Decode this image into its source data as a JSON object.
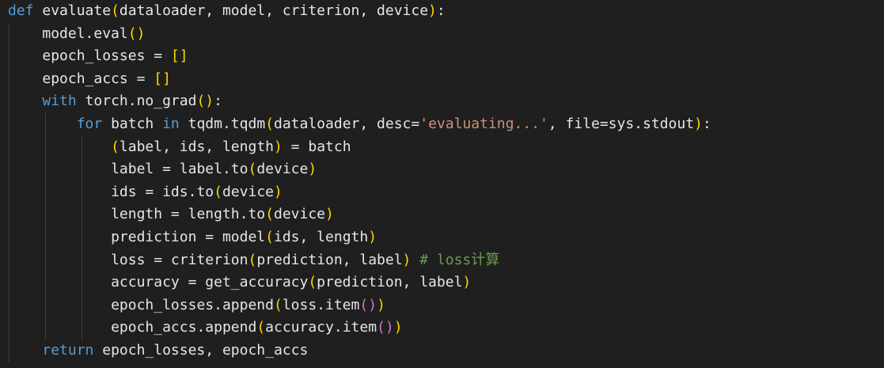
{
  "editor": {
    "language": "python",
    "theme_colors": {
      "background": "#1f1f1f",
      "keyword": "#569cd6",
      "function": "#dcdcaa",
      "string": "#ce9178",
      "comment": "#6a9955",
      "bracket_level_1": "#ffd700",
      "bracket_level_2": "#da70d6",
      "text": "#e6e6e6"
    },
    "lines": [
      {
        "indent": 0,
        "tokens": [
          {
            "t": "def",
            "c": "kw"
          },
          {
            "t": " ",
            "c": "txt"
          },
          {
            "t": "evaluate",
            "c": "txt"
          },
          {
            "t": "(",
            "c": "b1"
          },
          {
            "t": "dataloader, model, criterion, device",
            "c": "txt"
          },
          {
            "t": ")",
            "c": "b1"
          },
          {
            "t": ":",
            "c": "txt"
          }
        ]
      },
      {
        "indent": 1,
        "tokens": [
          {
            "t": "model.eval",
            "c": "txt"
          },
          {
            "t": "(",
            "c": "b1"
          },
          {
            "t": ")",
            "c": "b1"
          }
        ]
      },
      {
        "indent": 1,
        "tokens": [
          {
            "t": "epoch_losses = ",
            "c": "txt"
          },
          {
            "t": "[",
            "c": "b1"
          },
          {
            "t": "]",
            "c": "b1"
          }
        ]
      },
      {
        "indent": 1,
        "tokens": [
          {
            "t": "epoch_accs = ",
            "c": "txt"
          },
          {
            "t": "[",
            "c": "b1"
          },
          {
            "t": "]",
            "c": "b1"
          }
        ]
      },
      {
        "indent": 1,
        "tokens": [
          {
            "t": "with",
            "c": "kw"
          },
          {
            "t": " torch.no_grad",
            "c": "txt"
          },
          {
            "t": "(",
            "c": "b1"
          },
          {
            "t": ")",
            "c": "b1"
          },
          {
            "t": ":",
            "c": "txt"
          }
        ]
      },
      {
        "indent": 2,
        "tokens": [
          {
            "t": "for",
            "c": "kw"
          },
          {
            "t": " batch ",
            "c": "txt"
          },
          {
            "t": "in",
            "c": "kw"
          },
          {
            "t": " tqdm.tqdm",
            "c": "txt"
          },
          {
            "t": "(",
            "c": "b1"
          },
          {
            "t": "dataloader, desc=",
            "c": "txt"
          },
          {
            "t": "'evaluating...'",
            "c": "str"
          },
          {
            "t": ", file=sys.stdout",
            "c": "txt"
          },
          {
            "t": ")",
            "c": "b1"
          },
          {
            "t": ":",
            "c": "txt"
          }
        ]
      },
      {
        "indent": 3,
        "tokens": [
          {
            "t": "(",
            "c": "b1"
          },
          {
            "t": "label, ids, length",
            "c": "txt"
          },
          {
            "t": ")",
            "c": "b1"
          },
          {
            "t": " = batch",
            "c": "txt"
          }
        ]
      },
      {
        "indent": 3,
        "tokens": [
          {
            "t": "label = label.to",
            "c": "txt"
          },
          {
            "t": "(",
            "c": "b1"
          },
          {
            "t": "device",
            "c": "txt"
          },
          {
            "t": ")",
            "c": "b1"
          }
        ]
      },
      {
        "indent": 3,
        "tokens": [
          {
            "t": "ids = ids.to",
            "c": "txt"
          },
          {
            "t": "(",
            "c": "b1"
          },
          {
            "t": "device",
            "c": "txt"
          },
          {
            "t": ")",
            "c": "b1"
          }
        ]
      },
      {
        "indent": 3,
        "tokens": [
          {
            "t": "length = length.to",
            "c": "txt"
          },
          {
            "t": "(",
            "c": "b1"
          },
          {
            "t": "device",
            "c": "txt"
          },
          {
            "t": ")",
            "c": "b1"
          }
        ]
      },
      {
        "indent": 3,
        "tokens": [
          {
            "t": "prediction = model",
            "c": "txt"
          },
          {
            "t": "(",
            "c": "b1"
          },
          {
            "t": "ids, length",
            "c": "txt"
          },
          {
            "t": ")",
            "c": "b1"
          }
        ]
      },
      {
        "indent": 3,
        "tokens": [
          {
            "t": "loss = criterion",
            "c": "txt"
          },
          {
            "t": "(",
            "c": "b1"
          },
          {
            "t": "prediction, label",
            "c": "txt"
          },
          {
            "t": ")",
            "c": "b1"
          },
          {
            "t": " ",
            "c": "txt"
          },
          {
            "t": "# loss计算",
            "c": "com"
          }
        ]
      },
      {
        "indent": 3,
        "tokens": [
          {
            "t": "accuracy = get_accuracy",
            "c": "txt"
          },
          {
            "t": "(",
            "c": "b1"
          },
          {
            "t": "prediction, label",
            "c": "txt"
          },
          {
            "t": ")",
            "c": "b1"
          }
        ]
      },
      {
        "indent": 3,
        "tokens": [
          {
            "t": "epoch_losses.append",
            "c": "txt"
          },
          {
            "t": "(",
            "c": "b1"
          },
          {
            "t": "loss.item",
            "c": "txt"
          },
          {
            "t": "(",
            "c": "b2"
          },
          {
            "t": ")",
            "c": "b2"
          },
          {
            "t": ")",
            "c": "b1"
          }
        ]
      },
      {
        "indent": 3,
        "tokens": [
          {
            "t": "epoch_accs.append",
            "c": "txt"
          },
          {
            "t": "(",
            "c": "b1"
          },
          {
            "t": "accuracy.item",
            "c": "txt"
          },
          {
            "t": "(",
            "c": "b2"
          },
          {
            "t": ")",
            "c": "b2"
          },
          {
            "t": ")",
            "c": "b1"
          }
        ]
      },
      {
        "indent": 1,
        "tokens": [
          {
            "t": "return",
            "c": "kw"
          },
          {
            "t": " epoch_losses, epoch_accs",
            "c": "txt"
          }
        ]
      }
    ]
  }
}
